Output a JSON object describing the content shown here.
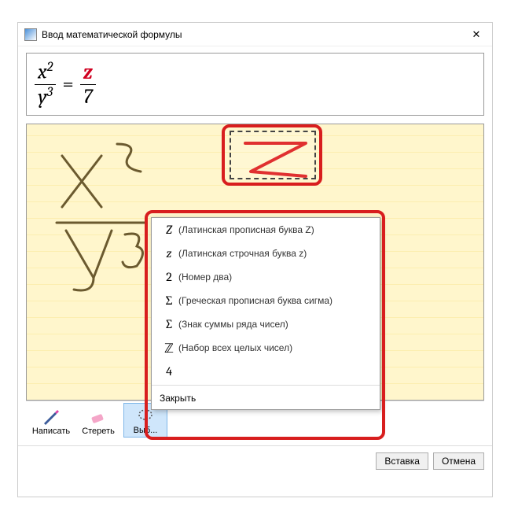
{
  "window": {
    "title": "Ввод математической формулы"
  },
  "formula": {
    "num1": "x",
    "sup1": "2",
    "den1": "y",
    "sup2": "3",
    "eq": "=",
    "num2": "z",
    "den2": "7"
  },
  "popup": {
    "items": [
      {
        "sym": "Z",
        "label": "(Латинская прописная буква Z)",
        "style": "italic"
      },
      {
        "sym": "z",
        "label": "(Латинская строчная буква z)",
        "style": "italic"
      },
      {
        "sym": "2",
        "label": "(Номер два)",
        "style": "normal"
      },
      {
        "sym": "Σ",
        "label": "(Греческая прописная буква сигма)",
        "style": "normal"
      },
      {
        "sym": "∑",
        "label": "(Знак суммы ряда чисел)",
        "style": "normal"
      },
      {
        "sym": "ℤ",
        "label": "(Набор всех целых чисел)",
        "style": "normal"
      },
      {
        "sym": "4",
        "label": "",
        "style": "normal"
      }
    ],
    "close": "Закрыть"
  },
  "toolbar": {
    "write": "Написать",
    "erase": "Стереть",
    "select": "Выб..."
  },
  "footer": {
    "insert": "Вставка",
    "cancel": "Отмена"
  }
}
